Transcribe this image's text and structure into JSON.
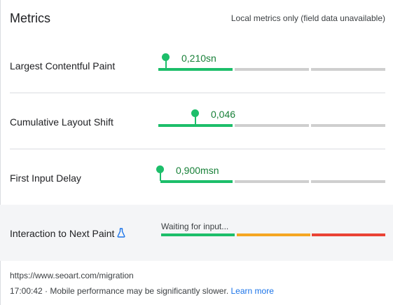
{
  "header": {
    "title": "Metrics",
    "subtitle": "Local metrics only (field data unavailable)"
  },
  "metrics": [
    {
      "name": "Largest Contentful Paint",
      "value": "0,210sn",
      "status_color": "#1dbe6a"
    },
    {
      "name": "Cumulative Layout Shift",
      "value": "0,046",
      "status_color": "#1dbe6a"
    },
    {
      "name": "First Input Delay",
      "value": "0,900msn",
      "status_color": "#1dbe6a"
    }
  ],
  "inp": {
    "name": "Interaction to Next Paint",
    "icon": "flask-icon",
    "status": "Waiting for input...",
    "colors": {
      "good": "#1dbe6a",
      "needs_improvement": "#f5a623",
      "poor": "#ea4335"
    }
  },
  "footer": {
    "url": "https://www.seoart.com/migration",
    "note": "17:00:42 · Mobile performance may be significantly slower.",
    "link_label": "Learn more",
    "link_color": "#1a73e8"
  }
}
